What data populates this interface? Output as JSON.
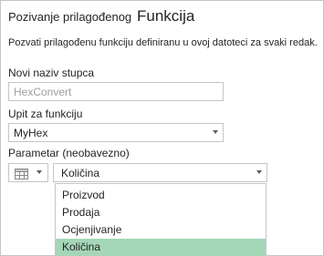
{
  "header": {
    "title_prefix": "Pozivanje prilagođenog",
    "title_main": "Funkcija"
  },
  "description": "Pozvati prilagođenu funkciju definiranu u ovoj datoteci za svaki redak.",
  "new_column": {
    "label": "Novi naziv stupca",
    "value": "HexConvert"
  },
  "function_query": {
    "label": "Upit za funkciju",
    "value": "MyHex"
  },
  "parameter": {
    "label": "Parametar (neobavezno)",
    "type_icon": "table-icon",
    "selected": "Količina",
    "options": [
      {
        "label": "Proizvod"
      },
      {
        "label": "Prodaja"
      },
      {
        "label": "Ocjenjivanje"
      },
      {
        "label": "Količina"
      }
    ],
    "highlighted_index": 3
  },
  "colors": {
    "selection_highlight": "#a5d6b8",
    "border": "#c8c6c4",
    "text": "#252423",
    "placeholder_text": "#a19f9d"
  }
}
